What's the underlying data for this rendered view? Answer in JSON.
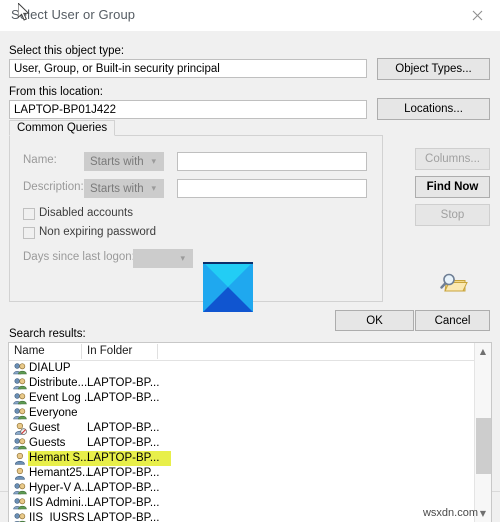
{
  "window": {
    "title": "Select User or Group",
    "close_icon": "close-icon"
  },
  "object_type": {
    "label": "Select this object type:",
    "value": "User, Group, or Built-in security principal",
    "button": "Object Types..."
  },
  "location": {
    "label": "From this location:",
    "value": "LAPTOP-BP01J422",
    "button": "Locations..."
  },
  "common_queries": {
    "tab_label": "Common Queries",
    "name": {
      "label": "Name:",
      "operator": "Starts with",
      "value": "",
      "placeholder": ""
    },
    "description": {
      "label": "Description:",
      "operator": "Starts with",
      "value": "",
      "placeholder": ""
    },
    "disabled_accounts": {
      "label": "Disabled accounts",
      "checked": false
    },
    "non_expiring_password": {
      "label": "Non expiring password",
      "checked": false
    },
    "days_since_last_logon": {
      "label": "Days since last logon:",
      "value": ""
    }
  },
  "side_buttons": {
    "columns": "Columns...",
    "find_now": "Find Now",
    "stop": "Stop",
    "find_icon": "magnifier-folder-icon"
  },
  "footer": {
    "ok": "OK",
    "cancel": "Cancel"
  },
  "results": {
    "label": "Search results:",
    "columns": [
      "Name",
      "In Folder"
    ],
    "rows": [
      {
        "icon": "group-icon",
        "name": "DIALUP",
        "folder": ""
      },
      {
        "icon": "group-icon",
        "name": "Distribute...",
        "folder": "LAPTOP-BP..."
      },
      {
        "icon": "group-icon",
        "name": "Event Log ...",
        "folder": "LAPTOP-BP..."
      },
      {
        "icon": "group-icon",
        "name": "Everyone",
        "folder": ""
      },
      {
        "icon": "user-disabled-icon",
        "name": "Guest",
        "folder": "LAPTOP-BP..."
      },
      {
        "icon": "group-icon",
        "name": "Guests",
        "folder": "LAPTOP-BP..."
      },
      {
        "icon": "user-icon",
        "name": "Hemant S...",
        "folder": "LAPTOP-BP...",
        "selected": true
      },
      {
        "icon": "user-icon",
        "name": "Hemant25...",
        "folder": "LAPTOP-BP..."
      },
      {
        "icon": "group-icon",
        "name": "Hyper-V A...",
        "folder": "LAPTOP-BP..."
      },
      {
        "icon": "group-icon",
        "name": "IIS Admini...",
        "folder": "LAPTOP-BP..."
      },
      {
        "icon": "group-icon",
        "name": "IIS_IUSRS",
        "folder": "LAPTOP-BP..."
      }
    ],
    "scrollbar": {
      "up_arrow": "chevron-up-icon",
      "down_arrow": "chevron-down-icon"
    }
  },
  "watermark": {
    "text": "wsxdn.com"
  },
  "colors": {
    "selection_highlight": "#e8ef4a",
    "dialog_background": "#f0f0f0",
    "logo_cyan": "#00b0f0",
    "logo_blue": "#1055d0"
  }
}
